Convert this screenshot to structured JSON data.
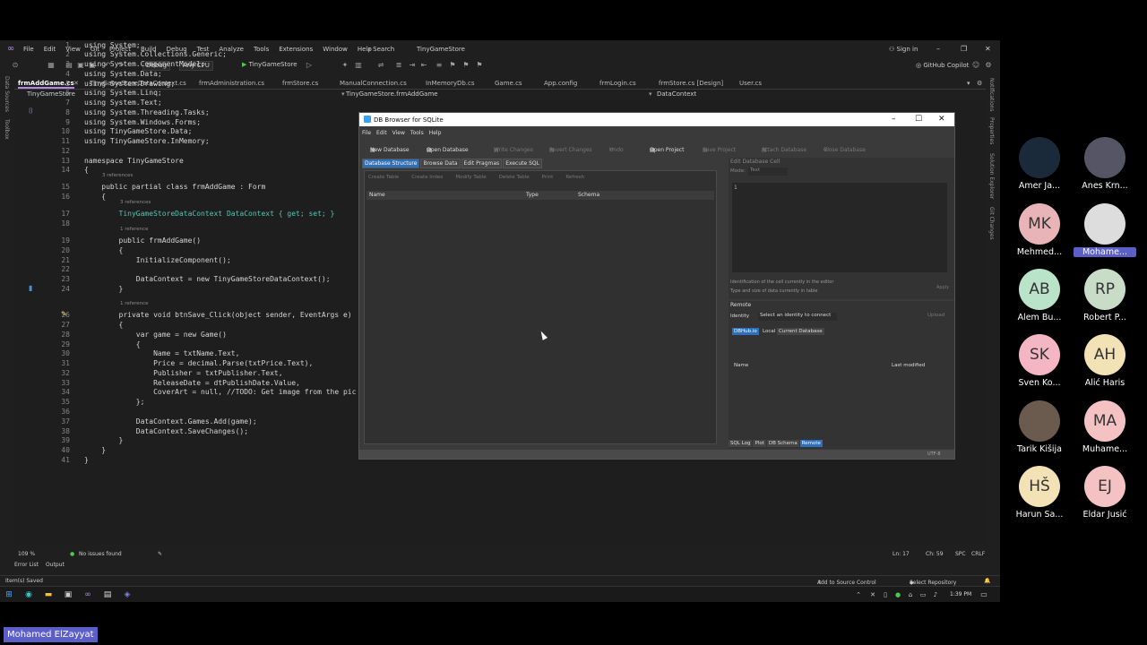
{
  "vs": {
    "menu": [
      "File",
      "Edit",
      "View",
      "Git",
      "Project",
      "Build",
      "Debug",
      "Test",
      "Analyze",
      "Tools",
      "Extensions",
      "Window",
      "Help"
    ],
    "search": "Search",
    "solution": "TinyGameStore",
    "signin": "Sign in",
    "toolbar": {
      "config": "Debug",
      "platform": "Any CPU",
      "run": "TinyGameStore",
      "copilot": "GitHub Copilot"
    },
    "tabs": [
      "frmAddGame.cs",
      "TinyGameStoreDataContext.cs",
      "frmAdministration.cs",
      "frmStore.cs",
      "ManualConnection.cs",
      "InMemoryDb.cs",
      "Game.cs",
      "App.config",
      "frmLogin.cs",
      "frmStore.cs [Design]",
      "User.cs"
    ],
    "nav": {
      "project": "TinyGameStore",
      "class": "TinyGameStore.frmAddGame",
      "member": "DataContext"
    },
    "left_strip": [
      "Data Sources",
      "Toolbox"
    ],
    "right_strip": [
      "Notifications",
      "Properties",
      "Solution Explorer",
      "Git Changes"
    ],
    "code_lines": [
      {
        "n": "1",
        "t": "using System;"
      },
      {
        "n": "2",
        "t": "using System.Collections.Generic;"
      },
      {
        "n": "3",
        "t": "using System.ComponentModel;"
      },
      {
        "n": "4",
        "t": "using System.Data;"
      },
      {
        "n": "5",
        "t": "using System.Drawing;"
      },
      {
        "n": "6",
        "t": "using System.Linq;"
      },
      {
        "n": "7",
        "t": "using System.Text;"
      },
      {
        "n": "8",
        "t": "using System.Threading.Tasks;"
      },
      {
        "n": "9",
        "t": "using System.Windows.Forms;"
      },
      {
        "n": "10",
        "t": "using TinyGameStore.Data;"
      },
      {
        "n": "11",
        "t": "using TinyGameStore.InMemory;"
      },
      {
        "n": "12",
        "t": ""
      },
      {
        "n": "13",
        "t": "namespace TinyGameStore"
      },
      {
        "n": "14",
        "t": "{"
      },
      {
        "n": "15",
        "t": "    public partial class frmAddGame : Form"
      },
      {
        "n": "16",
        "t": "    {"
      },
      {
        "n": "17",
        "t": "        TinyGameStoreDataContext DataContext { get; set; }"
      },
      {
        "n": "18",
        "t": ""
      },
      {
        "n": "19",
        "t": "        public frmAddGame()"
      },
      {
        "n": "20",
        "t": "        {"
      },
      {
        "n": "21",
        "t": "            InitializeComponent();"
      },
      {
        "n": "22",
        "t": ""
      },
      {
        "n": "23",
        "t": "            DataContext = new TinyGameStoreDataContext();"
      },
      {
        "n": "24",
        "t": "        }"
      },
      {
        "n": "26",
        "t": "        private void btnSave_Click(object sender, EventArgs e)"
      },
      {
        "n": "27",
        "t": "        {"
      },
      {
        "n": "28",
        "t": "            var game = new Game()"
      },
      {
        "n": "29",
        "t": "            {"
      },
      {
        "n": "30",
        "t": "                Name = txtName.Text,"
      },
      {
        "n": "31",
        "t": "                Price = decimal.Parse(txtPrice.Text),"
      },
      {
        "n": "32",
        "t": "                Publisher = txtPublisher.Text,"
      },
      {
        "n": "33",
        "t": "                ReleaseDate = dtPublishDate.Value,"
      },
      {
        "n": "34",
        "t": "                CoverArt = null, //TODO: Get image from the pic"
      },
      {
        "n": "35",
        "t": "            };"
      },
      {
        "n": "36",
        "t": ""
      },
      {
        "n": "37",
        "t": "            DataContext.Games.Add(game);"
      },
      {
        "n": "38",
        "t": "            DataContext.SaveChanges();"
      },
      {
        "n": "39",
        "t": "        }"
      },
      {
        "n": "40",
        "t": "    }"
      },
      {
        "n": "41",
        "t": "}"
      }
    ],
    "refs": {
      "r15": "3 references",
      "r17": "3 references",
      "r19": "1 reference",
      "r26": "1 reference"
    },
    "status": {
      "zoom": "109 %",
      "issues": "No issues found",
      "pos": "Ln: 17",
      "col": "Ch: 59",
      "ws": "SPC",
      "eol": "CRLF"
    },
    "bottom_tabs": [
      "Error List",
      "Output"
    ],
    "statusbar": {
      "saved": "Item(s) Saved",
      "source": "Add to Source Control",
      "repo": "Select Repository"
    },
    "clock": "1:39 PM"
  },
  "sqlite": {
    "title": "DB Browser for SQLite",
    "menu": [
      "File",
      "Edit",
      "View",
      "Tools",
      "Help"
    ],
    "toolbar": [
      "New Database",
      "Open Database",
      "Write Changes",
      "Revert Changes",
      "Undo",
      "Open Project",
      "Save Project",
      "Attach Database",
      "Close Database"
    ],
    "tabs": [
      "Database Structure",
      "Browse Data",
      "Edit Pragmas",
      "Execute SQL"
    ],
    "subtoolbar": [
      "Create Table",
      "Create Index",
      "Modify Table",
      "Delete Table",
      "Print",
      "Refresh"
    ],
    "columns": [
      "Name",
      "Type",
      "Schema"
    ],
    "edit_cell": {
      "title": "Edit Database Cell",
      "mode_label": "Mode:",
      "mode": "Text",
      "line": "1",
      "info1": "Identification of the cell currently in the editor",
      "info2": "Type and size of data currently in table",
      "apply": "Apply"
    },
    "remote": {
      "title": "Remote",
      "identity_label": "Identity",
      "identity": "Select an identity to connect",
      "upload": "Upload",
      "tabs": [
        "DBHub.io",
        "Local",
        "Current Database"
      ],
      "col_name": "Name",
      "col_modified": "Last modified"
    },
    "bottom_tabs": [
      "SQL Log",
      "Plot",
      "DB Schema",
      "Remote"
    ],
    "encoding": "UTF-8"
  },
  "participants": [
    {
      "initials": "",
      "name": "Amer Ja...",
      "color": "#1b2a3a"
    },
    {
      "initials": "",
      "name": "Anes Krn...",
      "color": "#556"
    },
    {
      "initials": "MK",
      "name": "Mehmed...",
      "color": "#e8b4b8"
    },
    {
      "initials": "",
      "name": "Mohame...",
      "color": "#ddd"
    },
    {
      "initials": "AB",
      "name": "Alem Bu...",
      "color": "#b9e4c9"
    },
    {
      "initials": "RP",
      "name": "Robert P...",
      "color": "#c9dcc8"
    },
    {
      "initials": "SK",
      "name": "Sven Ko...",
      "color": "#f4b6c2"
    },
    {
      "initials": "AH",
      "name": "Alić Haris",
      "color": "#f2e2b5"
    },
    {
      "initials": "",
      "name": "Tarik Kišija",
      "color": "#6b5a4e"
    },
    {
      "initials": "MA",
      "name": "Muhame...",
      "color": "#f4c2c2"
    },
    {
      "initials": "HŠ",
      "name": "Harun Sa...",
      "color": "#f2e2b5"
    },
    {
      "initials": "EJ",
      "name": "Eldar Jusić",
      "color": "#f4c2c2"
    }
  ],
  "presenter": "Mohamed ElZayyat"
}
